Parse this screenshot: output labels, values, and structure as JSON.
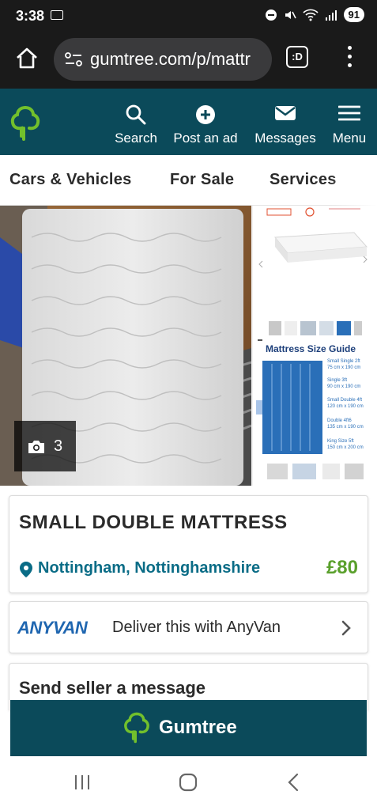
{
  "status_bar": {
    "time": "3:38",
    "battery": "91"
  },
  "browser": {
    "url": "gumtree.com/p/mattr",
    "tab_label": ":D"
  },
  "site_header": {
    "nav": [
      {
        "label": "Search",
        "icon": "search-icon"
      },
      {
        "label": "Post an ad",
        "icon": "plus-circle-icon"
      },
      {
        "label": "Messages",
        "icon": "envelope-icon"
      },
      {
        "label": "Menu",
        "icon": "hamburger-icon"
      }
    ]
  },
  "categories": [
    "Cars & Vehicles",
    "For Sale",
    "Services"
  ],
  "gallery": {
    "photo_count": "3",
    "size_guide_title": "Mattress Size Guide"
  },
  "size_rows": [
    "Small Single 2ft",
    "75 cm x 190 cm",
    "Single 3ft",
    "90 cm x 190 cm",
    "Small Double 4ft",
    "120 cm x 190 cm",
    "Double 4ft6",
    "135 cm x 190 cm",
    "King Size 5ft",
    "150 cm x 200 cm"
  ],
  "listing": {
    "title": "SMALL DOUBLE MATTRESS",
    "location": "Nottingham, Nottinghamshire",
    "price": "£80"
  },
  "delivery": {
    "brand": "ANYVAN",
    "text": "Deliver this with AnyVan"
  },
  "message": {
    "title": "Send seller a message"
  },
  "footer": {
    "brand": "Gumtree"
  },
  "colors": {
    "header": "#0b4a5a",
    "brand_green": "#5aa02c",
    "location_teal": "#0a6c86"
  }
}
